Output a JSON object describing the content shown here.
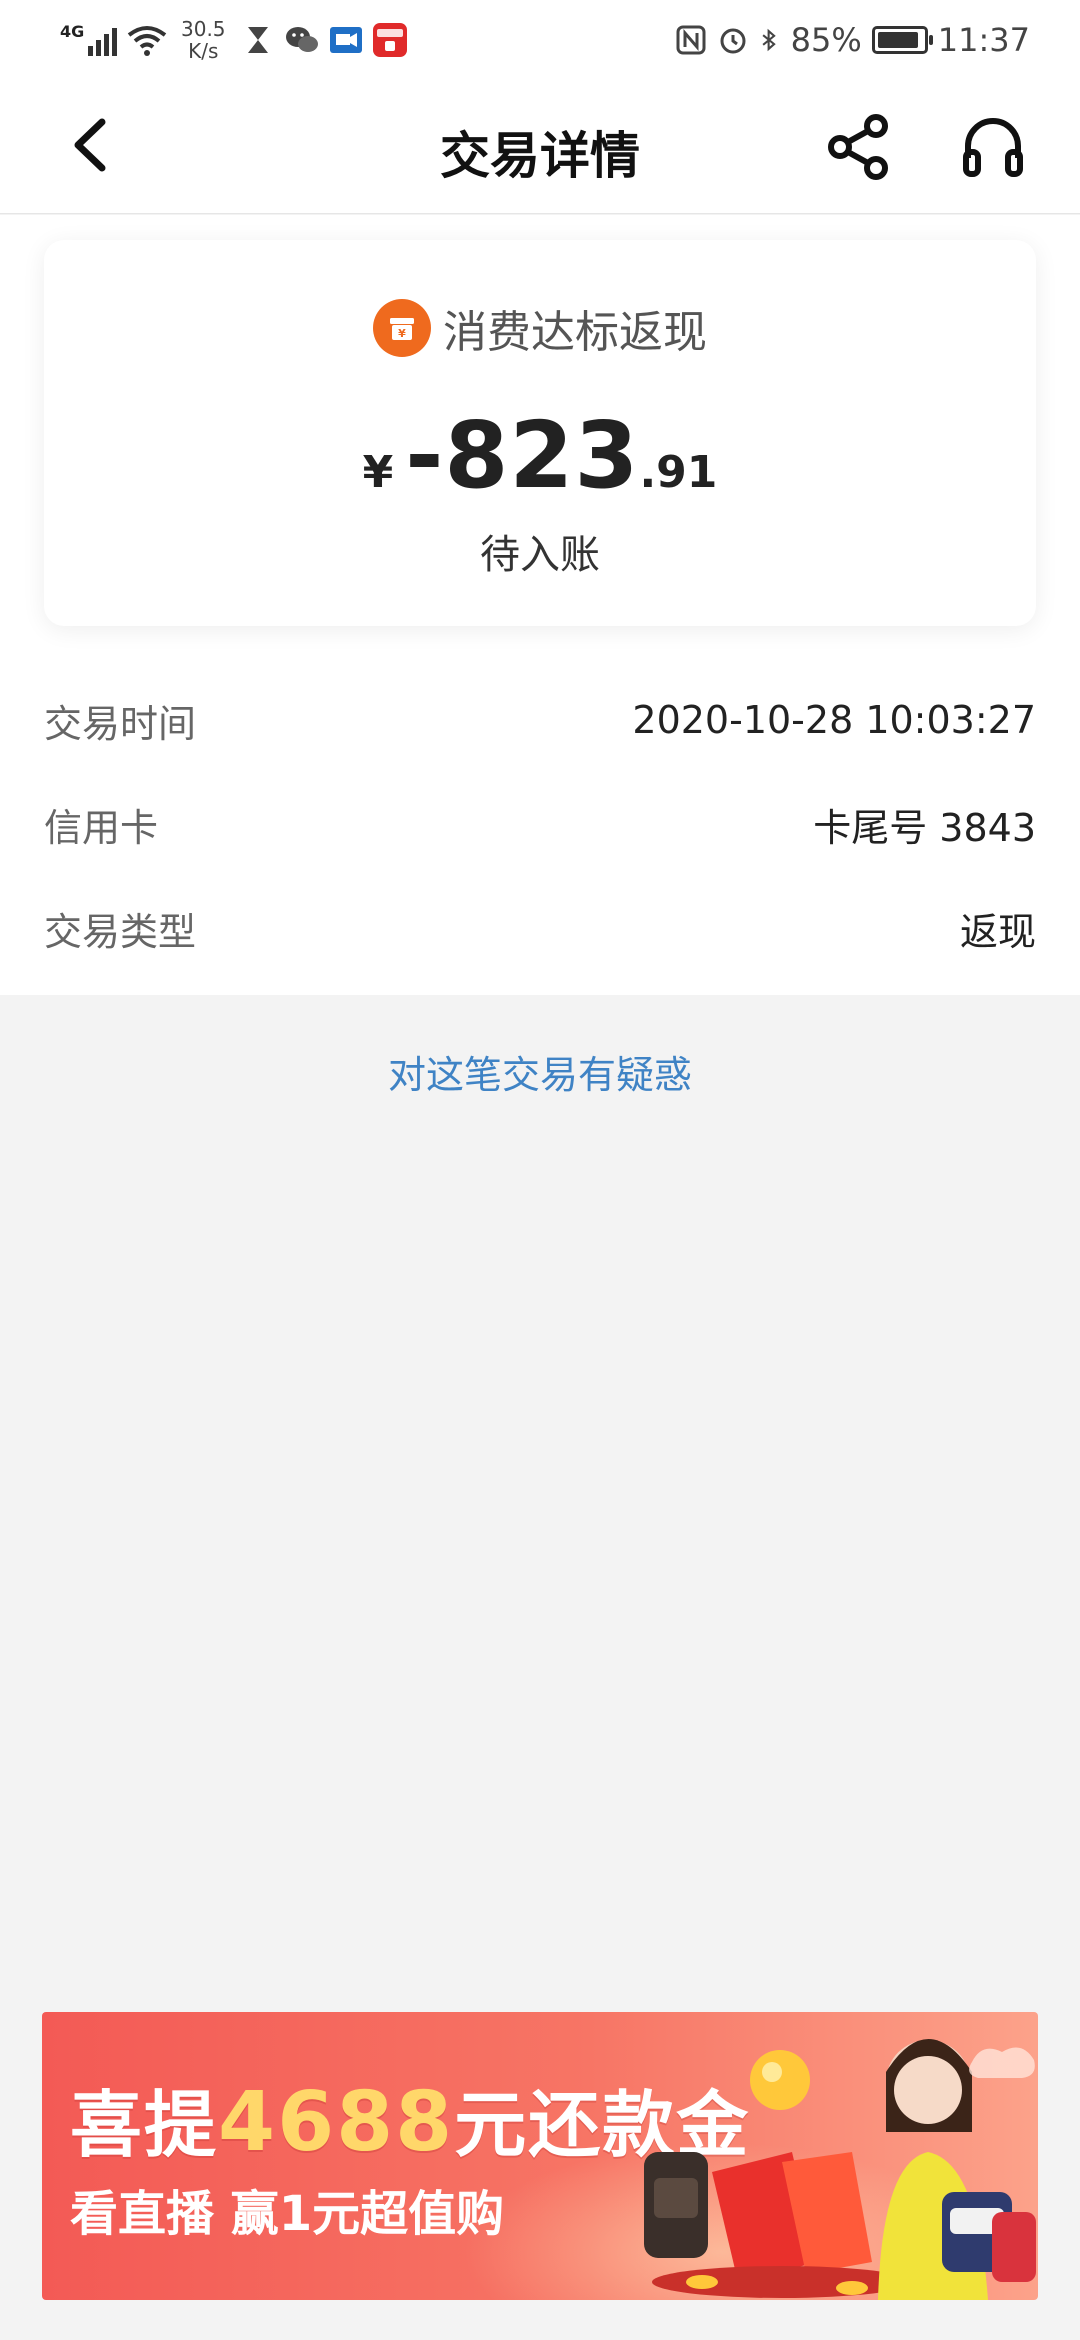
{
  "status_bar": {
    "network": "4G",
    "speed_value": "30.5",
    "speed_unit": "K/s",
    "battery": "85%",
    "time": "11:37"
  },
  "header": {
    "title": "交易详情"
  },
  "summary": {
    "category": "消费达标返现",
    "currency": "¥",
    "amount_int": "-823",
    "amount_dec": ".91",
    "status": "待入账"
  },
  "details": [
    {
      "label": "交易时间",
      "value": "2020-10-28 10:03:27"
    },
    {
      "label": "信用卡",
      "value": "卡尾号 3843"
    },
    {
      "label": "交易类型",
      "value": "返现"
    }
  ],
  "dispute_link": "对这笔交易有疑惑",
  "banner": {
    "title_prefix": "喜提",
    "title_number": "4688",
    "title_suffix": "元还款金",
    "subtitle": "看直播 赢1元超值购"
  },
  "colors": {
    "accent_orange": "#ef6a1e",
    "link_blue": "#3f83c5",
    "banner_red": "#f35a55"
  }
}
